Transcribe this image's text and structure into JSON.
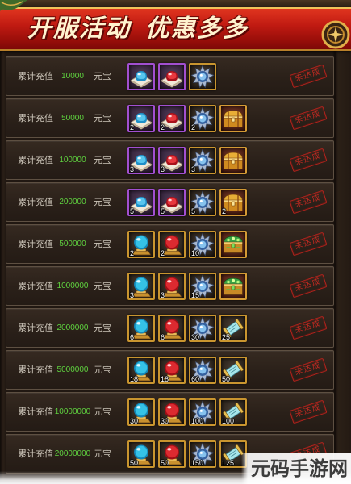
{
  "banner": {
    "title_part1": "开服活动",
    "title_part2": "优惠多多"
  },
  "rows": [
    {
      "label": "累计充值",
      "amount": "10000",
      "unit": "元宝",
      "status": "未达成",
      "items": [
        {
          "icon": "blue-gem-on-cushion-icon",
          "frame": "#a24fd0",
          "fill": "#3b2344"
        },
        {
          "icon": "red-gem-on-cushion-icon",
          "frame": "#a24fd0",
          "fill": "#3b2344"
        },
        {
          "icon": "silver-orb-icon",
          "frame": "#c9952f",
          "fill": "#2f2318"
        }
      ]
    },
    {
      "label": "累计充值",
      "amount": "50000",
      "unit": "元宝",
      "status": "未达成",
      "items": [
        {
          "icon": "blue-gem-on-cushion-icon",
          "frame": "#a24fd0",
          "fill": "#3b2344",
          "count": 2
        },
        {
          "icon": "red-gem-on-cushion-icon",
          "frame": "#a24fd0",
          "fill": "#3b2344",
          "count": 2
        },
        {
          "icon": "silver-orb-icon",
          "frame": "#c9952f",
          "fill": "#2f2318",
          "count": 2
        },
        {
          "icon": "gold-chest-icon",
          "frame": "#d39a35",
          "fill": "#64200f"
        }
      ]
    },
    {
      "label": "累计充值",
      "amount": "100000",
      "unit": "元宝",
      "status": "未达成",
      "items": [
        {
          "icon": "blue-gem-on-cushion-icon",
          "frame": "#a24fd0",
          "fill": "#3b2344",
          "count": 3
        },
        {
          "icon": "red-gem-on-cushion-icon",
          "frame": "#a24fd0",
          "fill": "#3b2344",
          "count": 3
        },
        {
          "icon": "silver-orb-icon",
          "frame": "#c9952f",
          "fill": "#2f2318",
          "count": 3
        },
        {
          "icon": "gold-chest-icon",
          "frame": "#d39a35",
          "fill": "#64200f"
        }
      ]
    },
    {
      "label": "累计充值",
      "amount": "200000",
      "unit": "元宝",
      "status": "未达成",
      "items": [
        {
          "icon": "blue-gem-on-cushion-icon",
          "frame": "#a24fd0",
          "fill": "#3b2344",
          "count": 5
        },
        {
          "icon": "red-gem-on-cushion-icon",
          "frame": "#a24fd0",
          "fill": "#3b2344",
          "count": 5
        },
        {
          "icon": "silver-orb-icon",
          "frame": "#c9952f",
          "fill": "#2f2318",
          "count": 5
        },
        {
          "icon": "gold-chest-icon",
          "frame": "#d39a35",
          "fill": "#64200f",
          "count": 2
        }
      ]
    },
    {
      "label": "累计充值",
      "amount": "500000",
      "unit": "元宝",
      "status": "未达成",
      "items": [
        {
          "icon": "blue-orb-on-stand-icon",
          "frame": "#c9952f",
          "fill": "#2f2318",
          "count": 2
        },
        {
          "icon": "red-orb-on-stand-icon",
          "frame": "#c9952f",
          "fill": "#2f2318",
          "count": 2
        },
        {
          "icon": "silver-orb-icon",
          "frame": "#c9952f",
          "fill": "#2f2318",
          "count": 10
        },
        {
          "icon": "green-chest-icon",
          "frame": "#d39a35",
          "fill": "#64200f"
        }
      ]
    },
    {
      "label": "累计充值",
      "amount": "1000000",
      "unit": "元宝",
      "status": "未达成",
      "items": [
        {
          "icon": "blue-orb-on-stand-icon",
          "frame": "#c9952f",
          "fill": "#2f2318",
          "count": 3
        },
        {
          "icon": "red-orb-on-stand-icon",
          "frame": "#c9952f",
          "fill": "#2f2318",
          "count": 3
        },
        {
          "icon": "silver-orb-icon",
          "frame": "#c9952f",
          "fill": "#2f2318",
          "count": 15
        },
        {
          "icon": "green-chest-icon",
          "frame": "#d39a35",
          "fill": "#64200f"
        }
      ]
    },
    {
      "label": "累计充值",
      "amount": "2000000",
      "unit": "元宝",
      "status": "未达成",
      "items": [
        {
          "icon": "blue-orb-on-stand-icon",
          "frame": "#c9952f",
          "fill": "#2f2318",
          "count": 6
        },
        {
          "icon": "red-orb-on-stand-icon",
          "frame": "#c9952f",
          "fill": "#2f2318",
          "count": 6
        },
        {
          "icon": "silver-orb-icon",
          "frame": "#c9952f",
          "fill": "#2f2318",
          "count": 30
        },
        {
          "icon": "scroll-icon",
          "frame": "#c9952f",
          "fill": "#2f2318",
          "count": 25
        }
      ]
    },
    {
      "label": "累计充值",
      "amount": "5000000",
      "unit": "元宝",
      "status": "未达成",
      "items": [
        {
          "icon": "blue-orb-on-stand-icon",
          "frame": "#c9952f",
          "fill": "#2f2318",
          "count": 18
        },
        {
          "icon": "red-orb-on-stand-icon",
          "frame": "#c9952f",
          "fill": "#2f2318",
          "count": 18
        },
        {
          "icon": "silver-orb-icon",
          "frame": "#c9952f",
          "fill": "#2f2318",
          "count": 60
        },
        {
          "icon": "scroll-icon",
          "frame": "#c9952f",
          "fill": "#2f2318",
          "count": 50
        }
      ]
    },
    {
      "label": "累计充值",
      "amount": "10000000",
      "unit": "元宝",
      "status": "未达成",
      "items": [
        {
          "icon": "blue-orb-on-stand-icon",
          "frame": "#c9952f",
          "fill": "#2f2318",
          "count": 30
        },
        {
          "icon": "red-orb-on-stand-icon",
          "frame": "#c9952f",
          "fill": "#2f2318",
          "count": 30
        },
        {
          "icon": "silver-orb-icon",
          "frame": "#c9952f",
          "fill": "#2f2318",
          "count": 100
        },
        {
          "icon": "scroll-icon",
          "frame": "#c9952f",
          "fill": "#2f2318",
          "count": 100
        }
      ]
    },
    {
      "label": "累计充值",
      "amount": "20000000",
      "unit": "元宝",
      "status": "未达成",
      "items": [
        {
          "icon": "blue-orb-on-stand-icon",
          "frame": "#c9952f",
          "fill": "#2f2318",
          "count": 50
        },
        {
          "icon": "red-orb-on-stand-icon",
          "frame": "#c9952f",
          "fill": "#2f2318",
          "count": 50
        },
        {
          "icon": "silver-orb-icon",
          "frame": "#c9952f",
          "fill": "#2f2318",
          "count": 150
        },
        {
          "icon": "scroll-icon",
          "frame": "#c9952f",
          "fill": "#2f2318",
          "count": 125
        }
      ]
    }
  ],
  "watermark": "元码手游网"
}
